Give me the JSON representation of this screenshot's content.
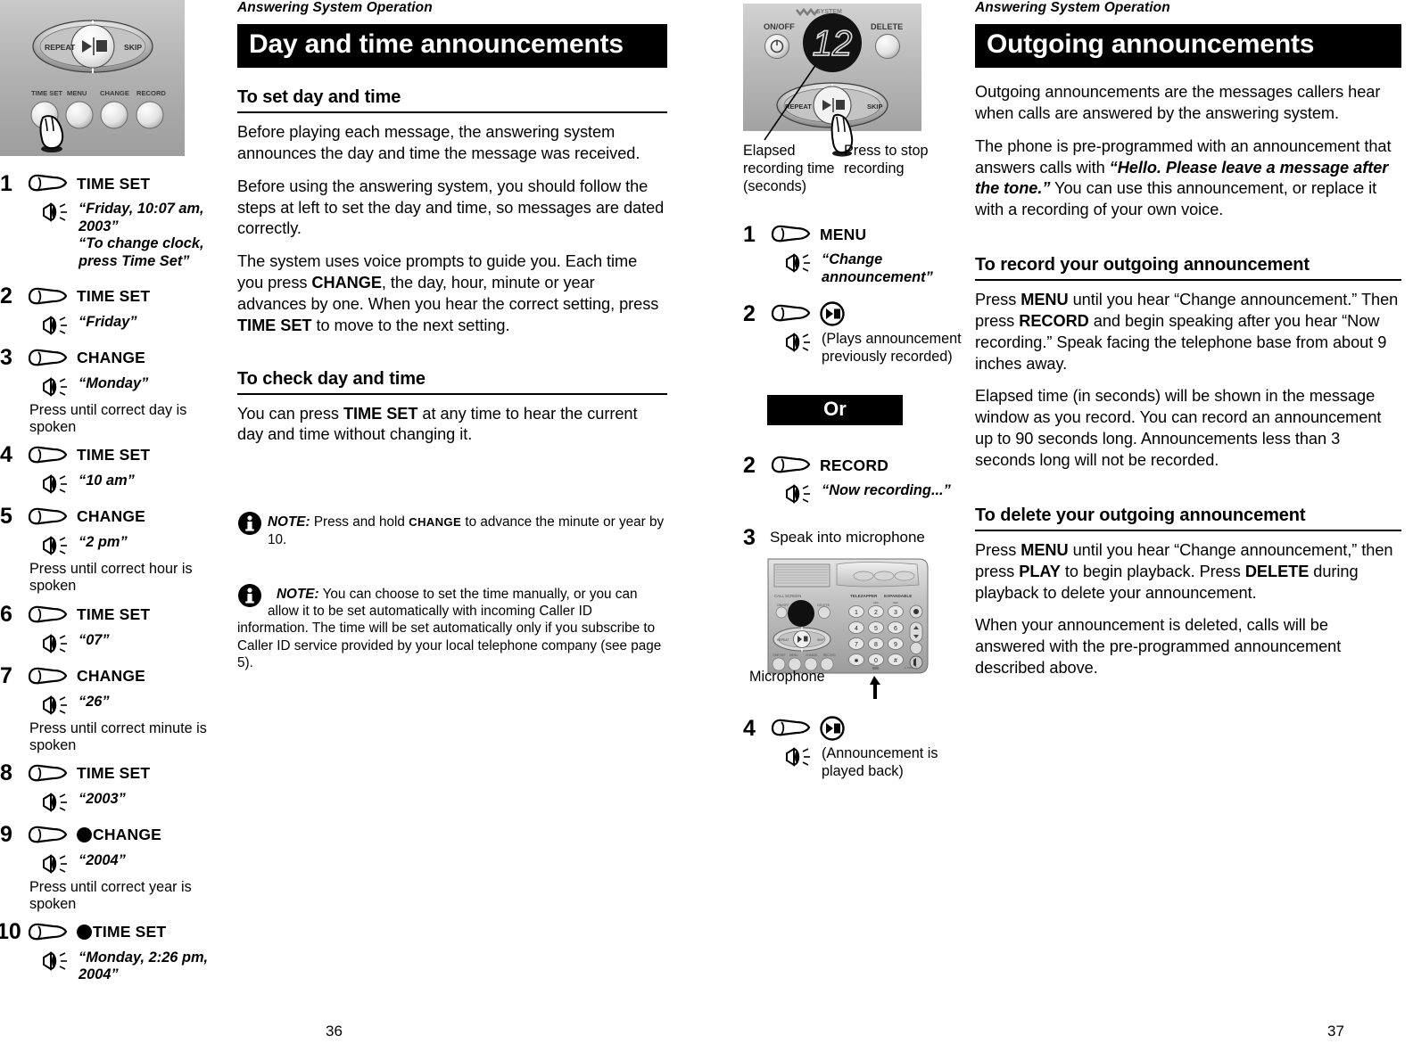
{
  "pages": {
    "left": {
      "running_head": "Answering System Operation",
      "number": "36",
      "banner": "Day and time announcements"
    },
    "right": {
      "running_head": "Answering System Operation",
      "number": "37",
      "banner": "Outgoing announcements"
    }
  },
  "left_page": {
    "device": {
      "labels": {
        "repeat": "REPEAT",
        "skip": "SKIP",
        "time_set": "TIME SET",
        "menu": "MENU",
        "change": "CHANGE",
        "record": "RECORD"
      }
    },
    "steps": [
      {
        "num": "1",
        "button": "TIME SET",
        "has_dot": false,
        "quote": "“Friday, 10:07 am, 2003”\n“To change clock,\npress Time Set”",
        "note": ""
      },
      {
        "num": "2",
        "button": "TIME SET",
        "has_dot": false,
        "quote": "“Friday”",
        "note": ""
      },
      {
        "num": "3",
        "button": "CHANGE",
        "has_dot": false,
        "quote": "“Monday”",
        "note": "Press until correct day is spoken"
      },
      {
        "num": "4",
        "button": "TIME SET",
        "has_dot": false,
        "quote": "“10 am”",
        "note": ""
      },
      {
        "num": "5",
        "button": "CHANGE",
        "has_dot": false,
        "quote": "“2 pm”",
        "note": "Press until correct hour is spoken"
      },
      {
        "num": "6",
        "button": "TIME SET",
        "has_dot": false,
        "quote": "“07”",
        "note": ""
      },
      {
        "num": "7",
        "button": "CHANGE",
        "has_dot": false,
        "quote": "“26”",
        "note": "Press until correct minute is spoken"
      },
      {
        "num": "8",
        "button": "TIME SET",
        "has_dot": false,
        "quote": "“2003”",
        "note": ""
      },
      {
        "num": "9",
        "button": "CHANGE",
        "has_dot": true,
        "quote": "“2004”",
        "note": "Press until correct year is spoken"
      },
      {
        "num": "10",
        "button": "TIME SET",
        "has_dot": true,
        "quote": "“Monday, 2:26 pm, 2004”",
        "note": ""
      }
    ],
    "section1": {
      "heading": "To set day and time",
      "p1": "Before playing each message, the answering system announces the day and time the message was received.",
      "p2": "Before using the answering system, you should follow the steps at left to set the day and time, so messages are dated correctly.",
      "p3_a": "The system uses voice prompts to guide you. Each time you press ",
      "p3_b": "CHANGE",
      "p3_c": ", the day, hour, minute or year advances by one. When you hear the correct setting, press ",
      "p3_d": "TIME SET",
      "p3_e": " to move to the next setting."
    },
    "section2": {
      "heading": "To check day and time",
      "p1_a": "You can press ",
      "p1_b": "TIME SET",
      "p1_c": " at any time to hear the current day and time without changing it."
    },
    "note1": {
      "label": "NOTE:",
      "a": " Press and hold ",
      "kw": "CHANGE",
      "b": " to advance the minute or year by 10."
    },
    "note2": {
      "label": "NOTE:",
      "text": " You can choose to set the time manually, or you can allow it to be set automatically with incoming Caller ID information. The time will be set automatically only if you subscribe to Caller ID service provided by your local telephone company (see page 5)."
    }
  },
  "right_page": {
    "device_top": {
      "system_label": "SYSTEM",
      "onoff": "ON/OFF",
      "delete": "DELETE",
      "display_value": "12",
      "repeat": "REPEAT",
      "skip": "SKIP",
      "callout_left": "Elapsed\nrecording time\n(seconds)",
      "callout_right": "Press to stop\nrecording"
    },
    "steps": [
      {
        "num": "1",
        "button": "MENU",
        "icon": "none",
        "quote": "“Change\nannouncement”",
        "italic": true
      },
      {
        "num": "2",
        "button": "",
        "icon": "play-stop",
        "quote": "(Plays announcement\npreviously recorded)",
        "italic": false
      }
    ],
    "or_label": "Or",
    "steps2": [
      {
        "num": "2",
        "button": "RECORD",
        "icon": "none",
        "quote": "“Now recording...”",
        "italic": true
      }
    ],
    "step3": {
      "num": "3",
      "text": "Speak into microphone",
      "mic_label": "Microphone"
    },
    "step4": {
      "num": "4",
      "icon": "play-stop",
      "quote": "(Announcement is\nplayed back)"
    },
    "phone_base": {
      "keys": [
        "1",
        "2",
        "3",
        "4",
        "5",
        "6",
        "7",
        "8",
        "9",
        "*",
        "0",
        "#"
      ],
      "key_sublabels": [
        "",
        "ABC",
        "DEF",
        "GHI",
        "JKL",
        "MNO",
        "PQRS",
        "TUV",
        "WXYZ",
        "",
        "",
        ""
      ]
    },
    "intro": {
      "p1": "Outgoing announcements are the messages callers hear when calls are answered by the answering system.",
      "p2_a": "The phone is pre-programmed with an announcement that answers calls with ",
      "p2_b": "“Hello. Please leave a message after the tone.”",
      "p2_c": " You can use this announcement, or replace it with a recording of your own voice."
    },
    "section_record": {
      "heading": "To record your outgoing announcement",
      "p1_a": "Press ",
      "p1_b": "MENU",
      "p1_c": " until you hear “Change announcement.” Then press ",
      "p1_d": "RECORD",
      "p1_e": " and begin speaking after you hear “Now recording.” Speak facing the telephone base from about 9 inches away.",
      "p2": "Elapsed time (in seconds) will be shown in the message window as you record. You can record an announcement up to 90 seconds long. Announcements less than 3 seconds long will not be recorded."
    },
    "section_delete": {
      "heading": "To delete your outgoing announcement",
      "p1_a": "Press ",
      "p1_b": "MENU",
      "p1_c": " until you hear “Change announcement,” then press ",
      "p1_d": "PLAY",
      "p1_e": " to begin playback. Press ",
      "p1_f": "DELETE",
      "p1_g": " during playback to delete your announcement.",
      "p2": "When your announcement is deleted, calls will be answered with the pre-programmed announcement described above."
    }
  },
  "colors": {
    "banner_bg": "#000000",
    "banner_fg": "#ffffff",
    "page_bg": "#ffffff",
    "device_gray": "#b4b4b4"
  }
}
